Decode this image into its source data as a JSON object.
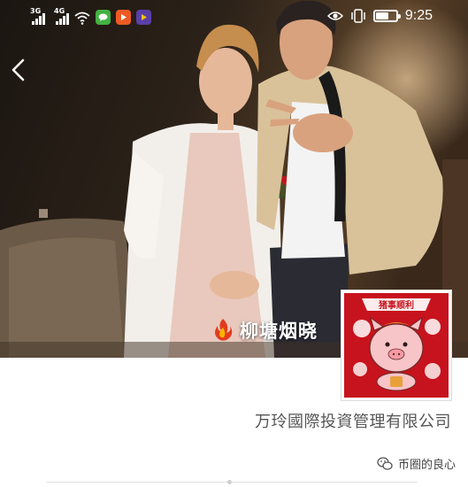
{
  "status_bar": {
    "network_1": "3G",
    "network_2": "4G",
    "time": "9:25",
    "battery_level": 0.6,
    "icons": [
      "signal-icon",
      "signal-icon",
      "wifi-icon",
      "chat-app-icon",
      "video-app-icon",
      "media-app-icon",
      "eye-icon",
      "vibrate-icon",
      "battery-icon"
    ]
  },
  "header": {
    "back_icon": "back-chevron-icon"
  },
  "profile": {
    "nickname": "柳塘烟晓",
    "badge_icon": "fire-badge-icon",
    "company": "万玲國際投資管理有限公司"
  },
  "avatar": {
    "banner_text": "猪事顺利"
  },
  "watermark": {
    "text": "币圈的良心",
    "icon": "wechat-icon"
  },
  "colors": {
    "photo_bg": "#2f261d",
    "avatar_red": "#c7131d",
    "text_gray": "#555555"
  }
}
